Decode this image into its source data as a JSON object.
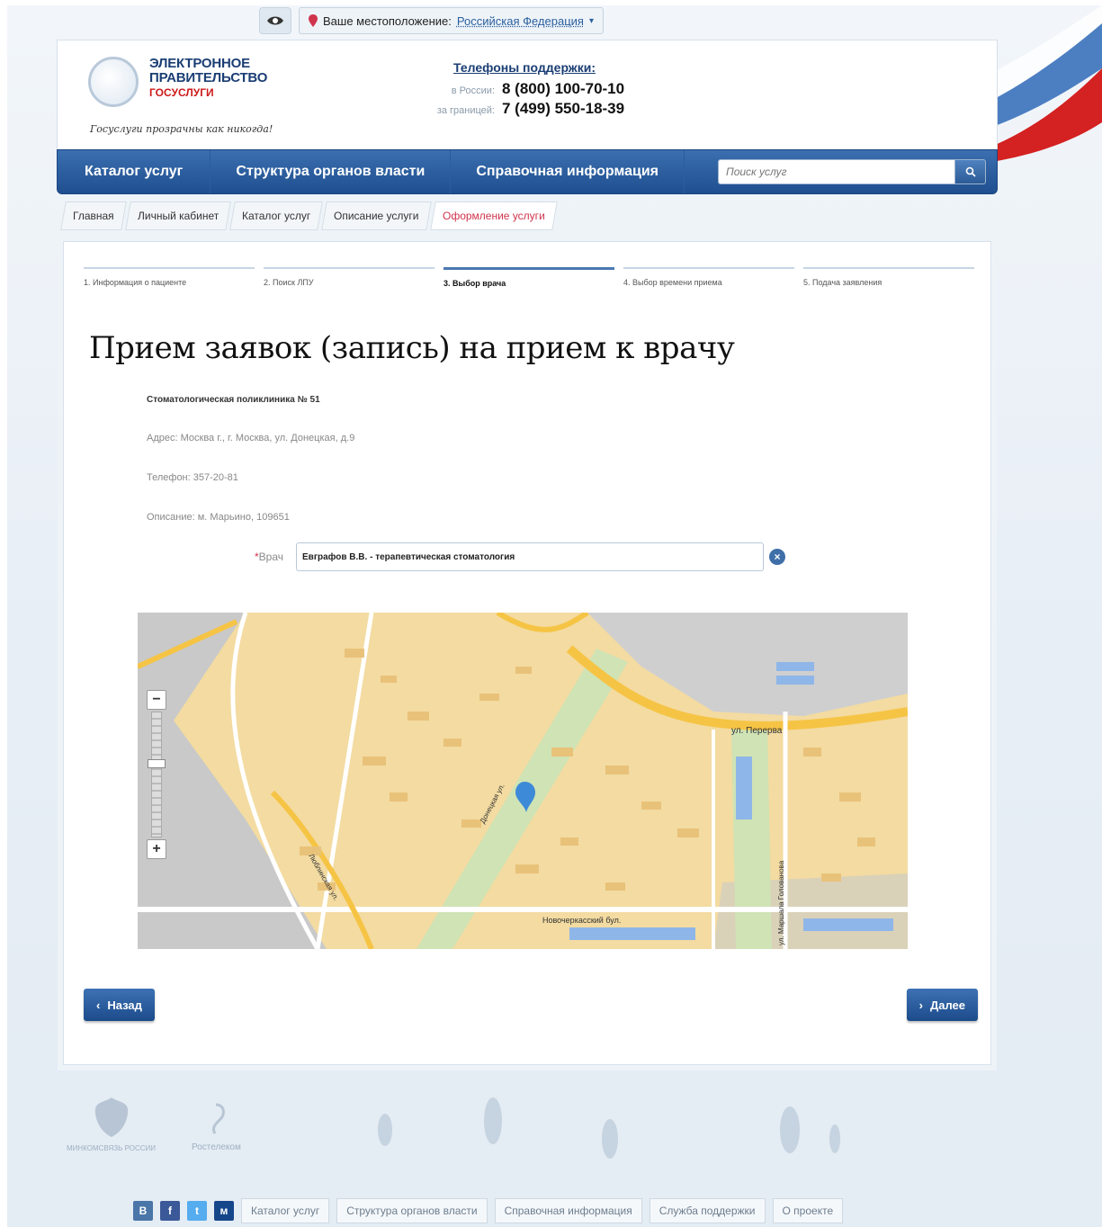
{
  "location": {
    "label": "Ваше местоположение:",
    "value": "Российская Федерация"
  },
  "logo": {
    "line1": "ЭЛЕКТРОННОЕ",
    "line2": "ПРАВИТЕЛЬСТВО",
    "line3": "ГОСУСЛУГИ",
    "slogan": "Госуслуги прозрачны как никогда!"
  },
  "support": {
    "title": "Телефоны поддержки:",
    "rows": [
      {
        "label": "в России:",
        "number": "8 (800) 100-70-10"
      },
      {
        "label": "за границей:",
        "number": "7 (499) 550-18-39"
      }
    ]
  },
  "nav": {
    "items": [
      "Каталог услуг",
      "Структура органов власти",
      "Справочная информация"
    ],
    "search_placeholder": "Поиск услуг"
  },
  "breadcrumbs": [
    "Главная",
    "Личный кабинет",
    "Каталог услуг",
    "Описание услуги",
    "Оформление услуги"
  ],
  "steps": [
    "1. Информация о пациенте",
    "2. Поиск ЛПУ",
    "3. Выбор врача",
    "4. Выбор времени приема",
    "5. Подача заявления"
  ],
  "active_step": 3,
  "page": {
    "title": "Прием заявок (запись) на прием к врачу",
    "clinic": "Стоматологическая поликлиника № 51",
    "address": "Адрес: Москва г., г. Москва, ул. Донецкая, д.9",
    "phone": "Телефон: 357-20-81",
    "description": "Описание: м. Марьино, 109651",
    "doctor_label": "Врач",
    "doctor_value": "Евграфов В.В. - терапевтическая стоматология"
  },
  "map": {
    "labels": [
      "ул. Перерва",
      "Новочеркасский бул.",
      "ул. Маршала Голованова",
      "Донецкая ул.",
      "Люблинская ул."
    ]
  },
  "buttons": {
    "back": "Назад",
    "next": "Далее"
  },
  "footer": {
    "ministry": "МИНКОМСВЯЗЬ РОССИИ",
    "operator": "Ростелеком",
    "social": [
      "В",
      "f",
      "t",
      "м"
    ],
    "links": [
      "Каталог услуг",
      "Структура органов власти",
      "Справочная информация",
      "Служба поддержки",
      "О проекте"
    ]
  },
  "colors": {
    "brand_blue": "#1f4f8f",
    "accent_red": "#d0344d",
    "map_land": "#f3dba1"
  }
}
